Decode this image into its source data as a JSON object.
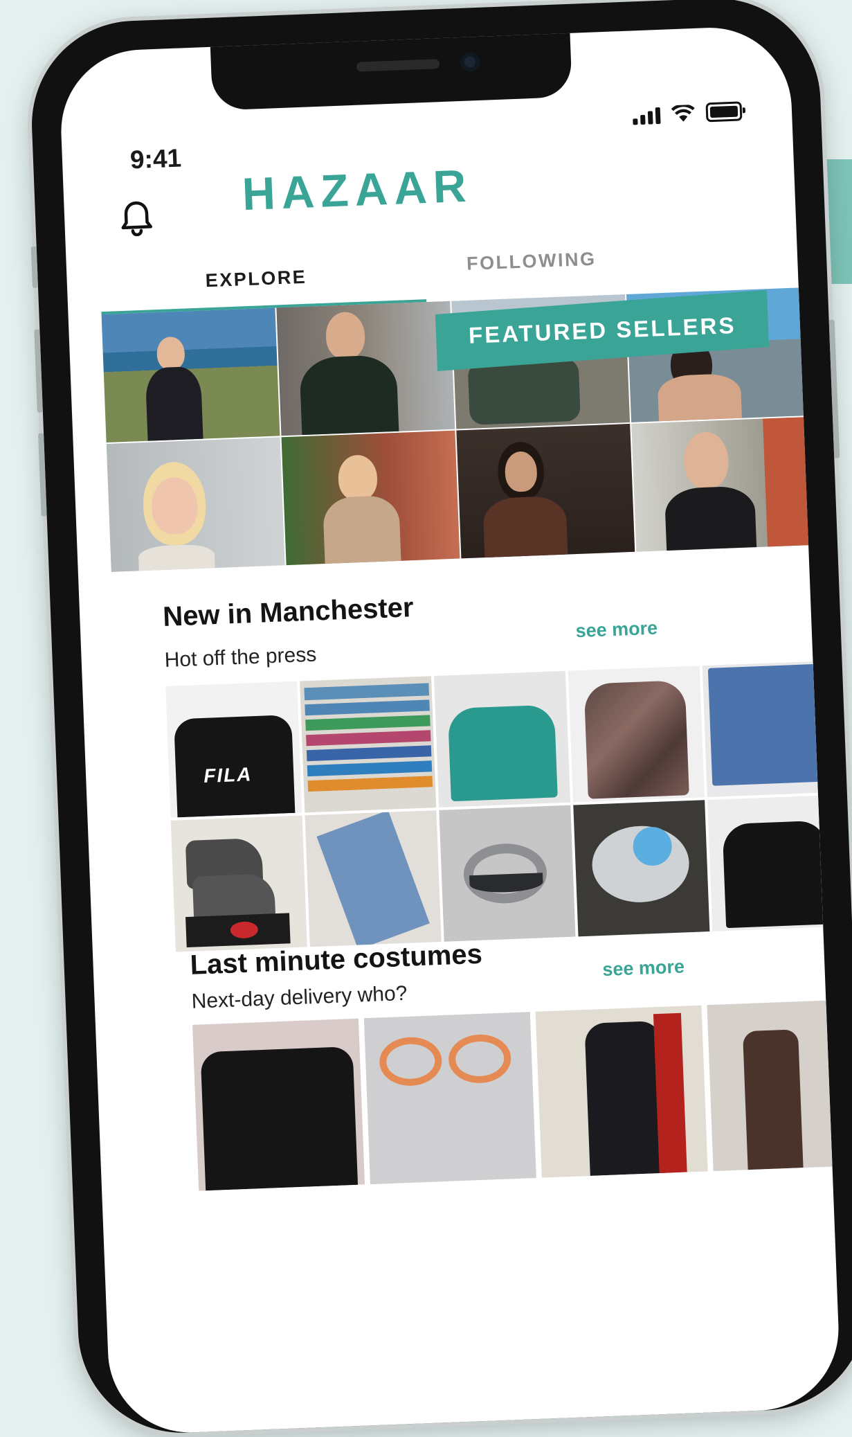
{
  "status": {
    "time": "9:41"
  },
  "app": {
    "logo": "HAZAAR"
  },
  "tabs": [
    {
      "label": "EXPLORE",
      "active": true
    },
    {
      "label": "FOLLOWING",
      "active": false
    }
  ],
  "featured": {
    "banner": "FEATURED SELLERS"
  },
  "sections": [
    {
      "title": "New in Manchester",
      "subtitle": "Hot off the press",
      "link": "see more"
    },
    {
      "title": "Last minute costumes",
      "subtitle": "Next-day delivery who?",
      "link": "see more"
    }
  ],
  "products": {
    "fila_print": "FILA"
  },
  "colors": {
    "accent": "#3aa497",
    "background": "#e3f0ee"
  }
}
